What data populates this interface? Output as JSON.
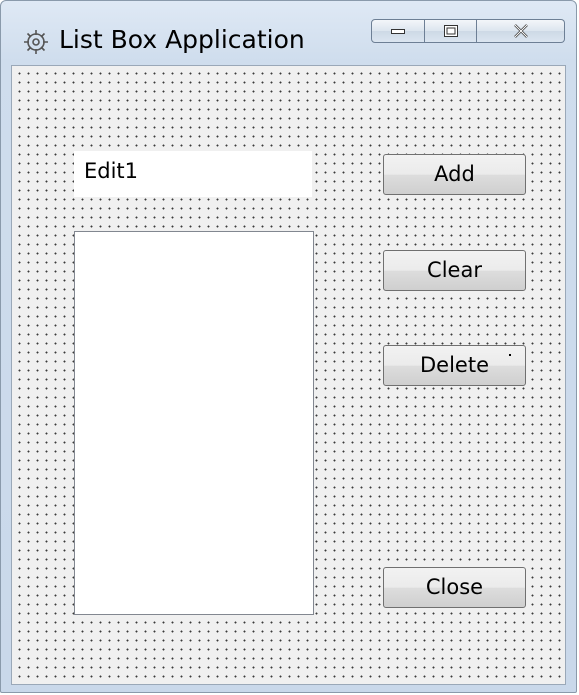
{
  "window": {
    "title": "List Box Application",
    "icon": "app-gear-icon"
  },
  "caption_buttons": {
    "minimize_icon": "minimize-icon",
    "maximize_icon": "maximize-icon",
    "close_icon": "close-icon"
  },
  "form": {
    "edit_value": "Edit1",
    "listbox_items": [],
    "buttons": {
      "add": "Add",
      "clear": "Clear",
      "delete": "Delete",
      "close": "Close"
    }
  },
  "colors": {
    "frame": "#cfdded",
    "client": "#f0f0f0",
    "grid_dot": "#3a3a3a"
  }
}
